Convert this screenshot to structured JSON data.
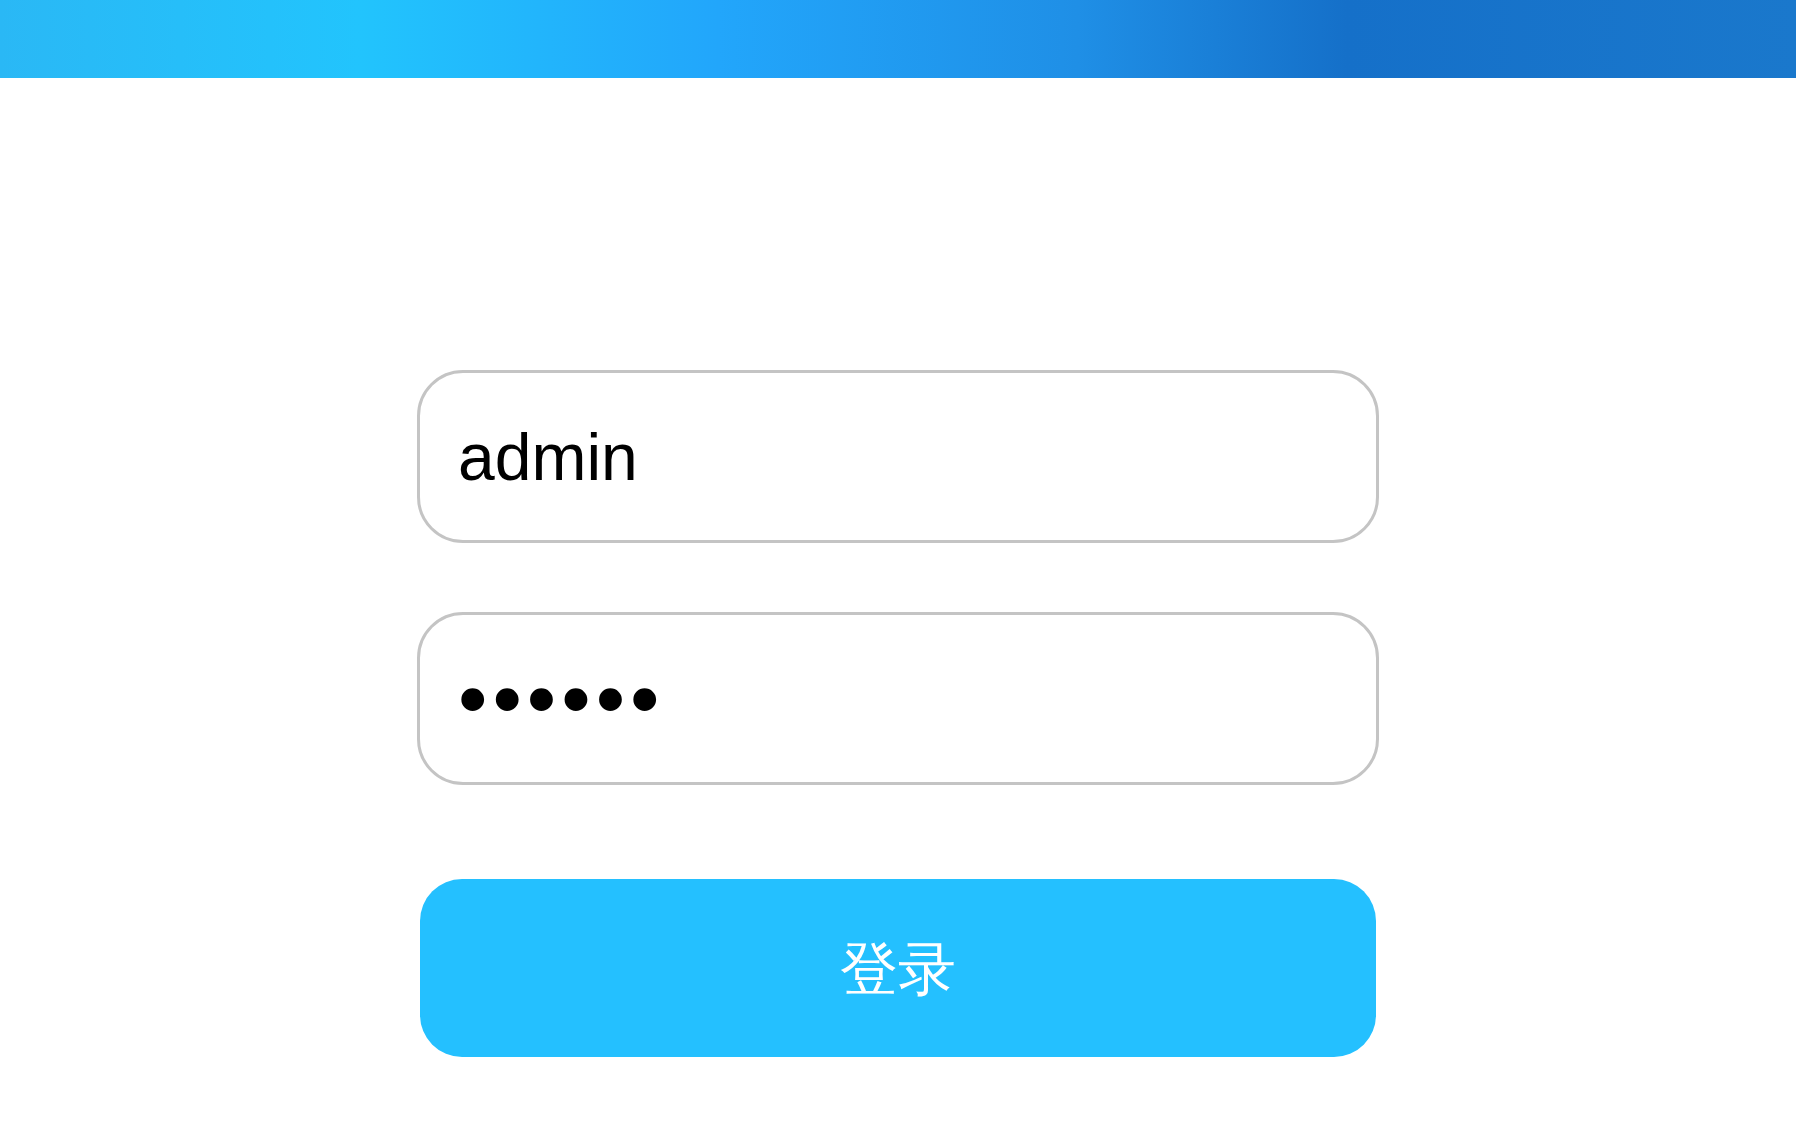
{
  "login_form": {
    "fields": [
      {
        "kind": "text",
        "value": "admin"
      },
      {
        "kind": "password",
        "value": "••••••"
      }
    ],
    "submit_button": {
      "label": "登录"
    }
  }
}
